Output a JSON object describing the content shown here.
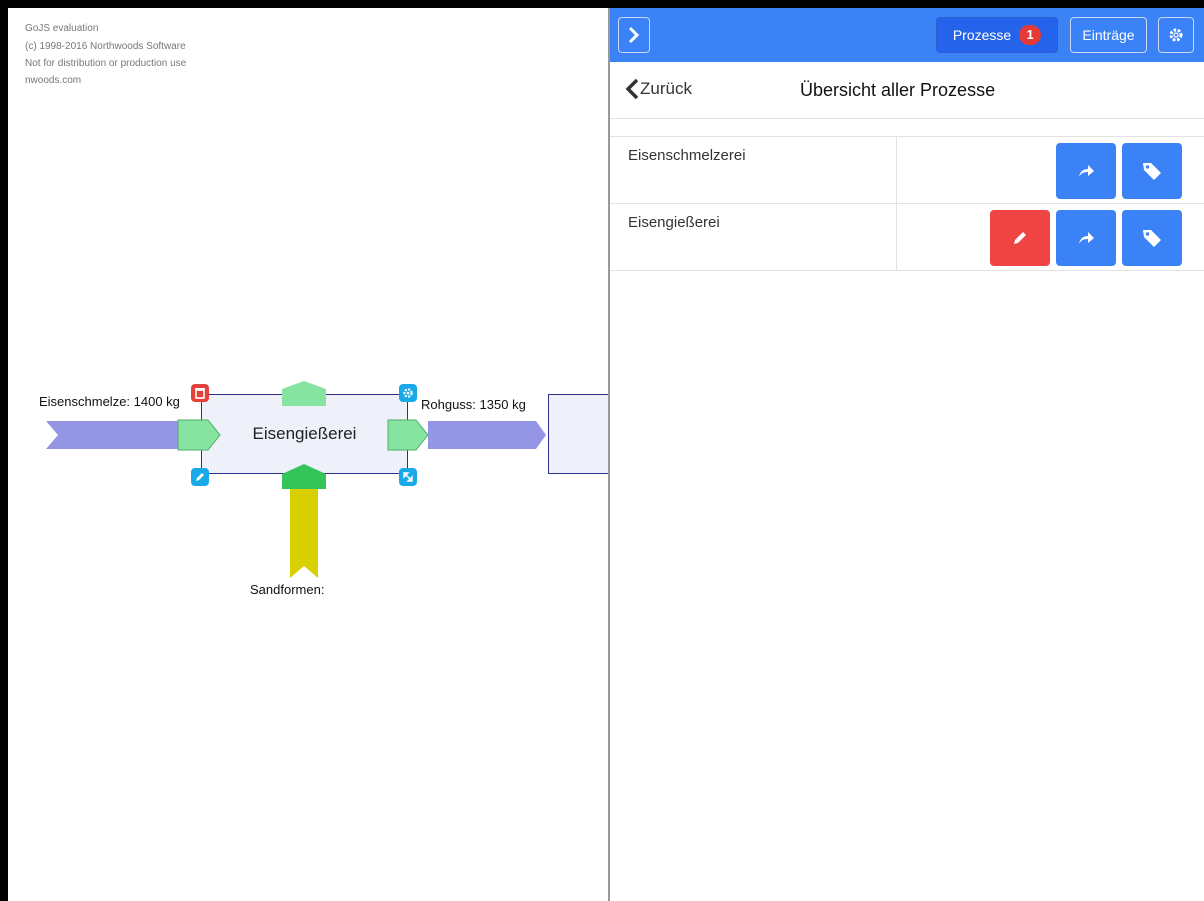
{
  "watermark": {
    "line1": "GoJS evaluation",
    "line2": "(c) 1998-2016 Northwoods Software",
    "line3": "Not for distribution or production use",
    "line4": "nwoods.com"
  },
  "diagram": {
    "node_label": "Eisengießerei",
    "input_link_label": "Eisenschmelze: 1400 kg",
    "output_link_label": "Rohguss: 1350 kg",
    "bottom_link_label": "Sandformen:",
    "colors": {
      "node_fill": "#eef0fa",
      "node_border": "#2c2f8c",
      "flow_purple": "#9595e6",
      "flow_yellow": "#d8d000",
      "port_green": "#86e3a0",
      "port_green_dark": "#35c45a",
      "adorn_red": "#e5413b",
      "adorn_cyan": "#1aa9e8"
    },
    "adornments": [
      "delete-icon",
      "gear-icon",
      "edit-icon",
      "resize-icon"
    ]
  },
  "topbar": {
    "collapse_icon": "chevron-right-icon",
    "prozesse_label": "Prozesse",
    "prozesse_badge": "1",
    "eintraege_label": "Einträge",
    "settings_icon": "gear-icon"
  },
  "subheader": {
    "back_label": "Zurück",
    "title": "Übersicht aller Prozesse"
  },
  "processes": [
    {
      "name": "Eisenschmelzerei",
      "actions": [
        "share-icon",
        "tag-icon"
      ]
    },
    {
      "name": "Eisengießerei",
      "actions": [
        "edit-icon",
        "share-icon",
        "tag-icon"
      ]
    }
  ],
  "colors": {
    "primary": "#3b82f6",
    "danger": "#ef4444"
  }
}
